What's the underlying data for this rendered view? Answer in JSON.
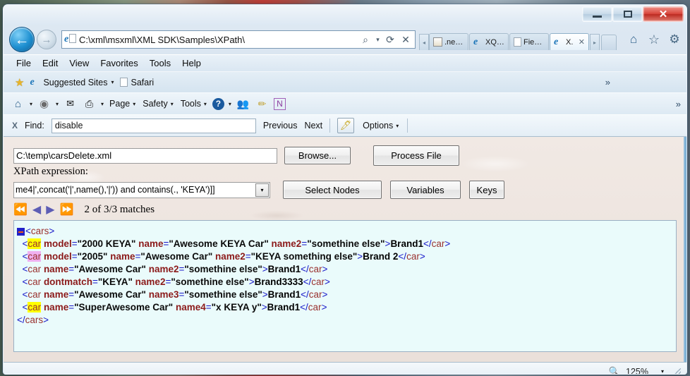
{
  "window": {
    "controls": {
      "minimize": "–",
      "maximize": "□",
      "close": "✕"
    }
  },
  "navigation": {
    "back_icon": "←",
    "forward_icon": "→",
    "url": "C:\\xml\\msxml\\XML SDK\\Samples\\XPath\\",
    "search_icon": "⌕",
    "search_caret": "▾",
    "refresh_icon": "⟳",
    "stop_icon": "✕",
    "tab_scroll_left": "◂",
    "tab_scroll_right": "▸"
  },
  "tabs": [
    {
      "label": ".ne…",
      "icon": "feed-icon",
      "active": false
    },
    {
      "label": "XQ…",
      "icon": "ie-icon",
      "active": false
    },
    {
      "label": "Fie…",
      "icon": "document-icon",
      "active": false
    },
    {
      "label": "X.",
      "icon": "ie-icon",
      "active": true,
      "close": "✕"
    }
  ],
  "nav_right": {
    "home": "⌂",
    "favorites": "☆",
    "settings": "⚙"
  },
  "menubar": [
    {
      "label": "File",
      "accel": "F"
    },
    {
      "label": "Edit",
      "accel": "E"
    },
    {
      "label": "View",
      "accel": "V"
    },
    {
      "label": "Favorites",
      "accel": "a"
    },
    {
      "label": "Tools",
      "accel": "T"
    },
    {
      "label": "Help",
      "accel": "H"
    }
  ],
  "favorites_bar": {
    "suggested_sites": "Suggested Sites",
    "safari": "Safari",
    "caret": "▾",
    "overflow": "»"
  },
  "command_bar": {
    "home_caret": "▾",
    "feeds_caret": "▾",
    "print_caret": "▾",
    "page": "Page",
    "safety": "Safety",
    "tools": "Tools",
    "help_caret": "▾",
    "caret": "▾",
    "overflow": "»"
  },
  "find_bar": {
    "close": "X",
    "label": "Find:",
    "value": "disable",
    "previous": "Previous",
    "next": "Next",
    "options": "Options",
    "caret": "▾"
  },
  "page": {
    "file_path": "C:\\temp\\carsDelete.xml",
    "browse_button": "Browse...",
    "process_button": "Process File",
    "xpath_label": "XPath expression:",
    "xpath_value": "me4|',concat('|',name(),'|')) and contains(., 'KEYA')]]",
    "xpath_drop_caret": "▾",
    "select_nodes_button": "Select Nodes",
    "variables_button": "Variables",
    "keys_button": "Keys",
    "nav_first": "⏪",
    "nav_prev": "◀",
    "nav_next": "▶",
    "nav_last": "⏩",
    "matches_text": "2 of 3/3 matches"
  },
  "xml": {
    "lines": [
      {
        "indent": 0,
        "collapse": true,
        "open": "<",
        "name": "cars",
        "close": ">",
        "attrs": [],
        "text": "",
        "closetag": ""
      },
      {
        "indent": 1,
        "name": "car",
        "highlight": "yellow",
        "attrs": [
          {
            "n": "model",
            "v": "2000 KEYA"
          },
          {
            "n": "name",
            "v": "Awesome KEYA Car"
          },
          {
            "n": "name2",
            "v": "somethine else"
          }
        ],
        "text": "Brand1",
        "closetag": "</car>"
      },
      {
        "indent": 1,
        "name": "car",
        "highlight": "pink",
        "attrs": [
          {
            "n": "model",
            "v": "2005"
          },
          {
            "n": "name",
            "v": "Awesome Car"
          },
          {
            "n": "name2",
            "v": "KEYA something else"
          }
        ],
        "text": "Brand 2",
        "closetag": "</car>"
      },
      {
        "indent": 1,
        "name": "car",
        "highlight": "none",
        "attrs": [
          {
            "n": "name",
            "v": "Awesome Car"
          },
          {
            "n": "name2",
            "v": "somethine else"
          }
        ],
        "text": "Brand1",
        "closetag": "</car>"
      },
      {
        "indent": 1,
        "name": "car",
        "highlight": "none",
        "attrs": [
          {
            "n": "dontmatch",
            "v": "KEYA"
          },
          {
            "n": "name2",
            "v": "somethine else"
          }
        ],
        "text": "Brand3333",
        "closetag": "</car>"
      },
      {
        "indent": 1,
        "name": "car",
        "highlight": "none",
        "attrs": [
          {
            "n": "name",
            "v": "Awesome Car"
          },
          {
            "n": "name3",
            "v": "somethine else"
          }
        ],
        "text": "Brand1",
        "closetag": "</car>"
      },
      {
        "indent": 1,
        "name": "car",
        "highlight": "yellow",
        "attrs": [
          {
            "n": "name",
            "v": "SuperAwesome Car"
          },
          {
            "n": "name4",
            "v": "x KEYA y"
          }
        ],
        "text": "Brand1",
        "closetag": "</car>"
      },
      {
        "indent": 0,
        "closing": true,
        "name": "cars"
      }
    ]
  },
  "status_bar": {
    "zoom_icon": "🔍",
    "zoom_level": "125%",
    "caret": "▾"
  },
  "colors": {
    "xml_background": "#eafbfb",
    "page_background": "#efe6e0",
    "highlight_current": "#f0b0f0",
    "highlight_match": "#ffff00",
    "tag_color": "#99312f",
    "attr_color": "#8b1a1a",
    "bracket_color": "#1515c8",
    "close_button": "#d8463c"
  }
}
